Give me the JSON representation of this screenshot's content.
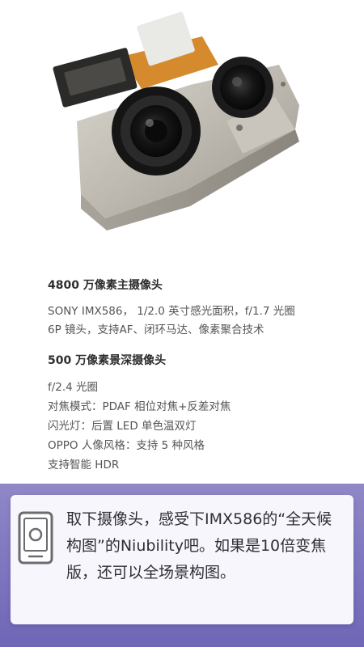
{
  "specs": {
    "main_camera_title": "4800 万像素主摄像头",
    "main_camera_line1": "SONY IMX586， 1/2.0 英寸感光面积，f/1.7 光圈",
    "main_camera_line2": "6P 镜头，支持AF、闭环马达、像素聚合技术",
    "depth_camera_title": "500 万像素景深摄像头",
    "depth_line1": "f/2.4 光圈",
    "depth_line2": "对焦模式：PDAF 相位对焦+反差对焦",
    "depth_line3": "闪光灯：后置 LED 单色温双灯",
    "depth_line4": "OPPO 人像风格：支持 5 种风格",
    "depth_line5": "支持智能 HDR"
  },
  "tip": {
    "text": "取下摄像头，感受下IMX586的“全天候构图”的Niubility吧。如果是10倍变焦版，还可以全场景构图。",
    "icon": "phone-icon"
  },
  "colors": {
    "band": "#7d75be",
    "card": "#f7f6fc"
  }
}
